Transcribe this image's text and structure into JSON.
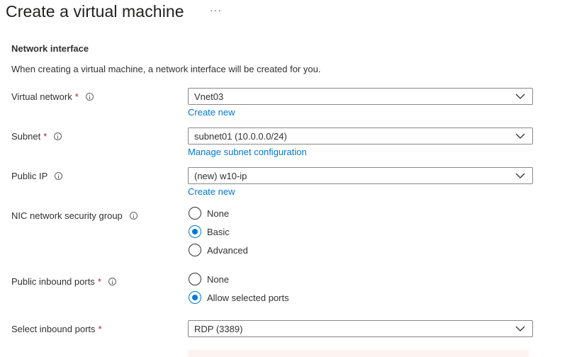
{
  "page": {
    "title": "Create a virtual machine",
    "more_label": "···"
  },
  "section": {
    "heading": "Network interface",
    "description": "When creating a virtual machine, a network interface will be created for you."
  },
  "fields": {
    "virtual_network": {
      "label": "Virtual network",
      "required": "*",
      "value": "Vnet03",
      "link": "Create new"
    },
    "subnet": {
      "label": "Subnet",
      "required": "*",
      "value": "subnet01 (10.0.0.0/24)",
      "link": "Manage subnet configuration"
    },
    "public_ip": {
      "label": "Public IP",
      "value": "(new) w10-ip",
      "link": "Create new"
    },
    "nic_nsg": {
      "label": "NIC network security group",
      "options": [
        "None",
        "Basic",
        "Advanced"
      ],
      "selected": "Basic"
    },
    "public_inbound_ports": {
      "label": "Public inbound ports",
      "required": "*",
      "options": [
        "None",
        "Allow selected ports"
      ],
      "selected": "Allow selected ports"
    },
    "select_inbound_ports": {
      "label": "Select inbound ports",
      "required": "*",
      "value": "RDP (3389)"
    }
  },
  "icons": {
    "info": "info-icon",
    "chevron": "chevron-down-icon"
  },
  "colors": {
    "accent": "#0078d4",
    "required": "#a4262c",
    "border": "#8a8886",
    "warning_bg": "#fdf3f1"
  }
}
